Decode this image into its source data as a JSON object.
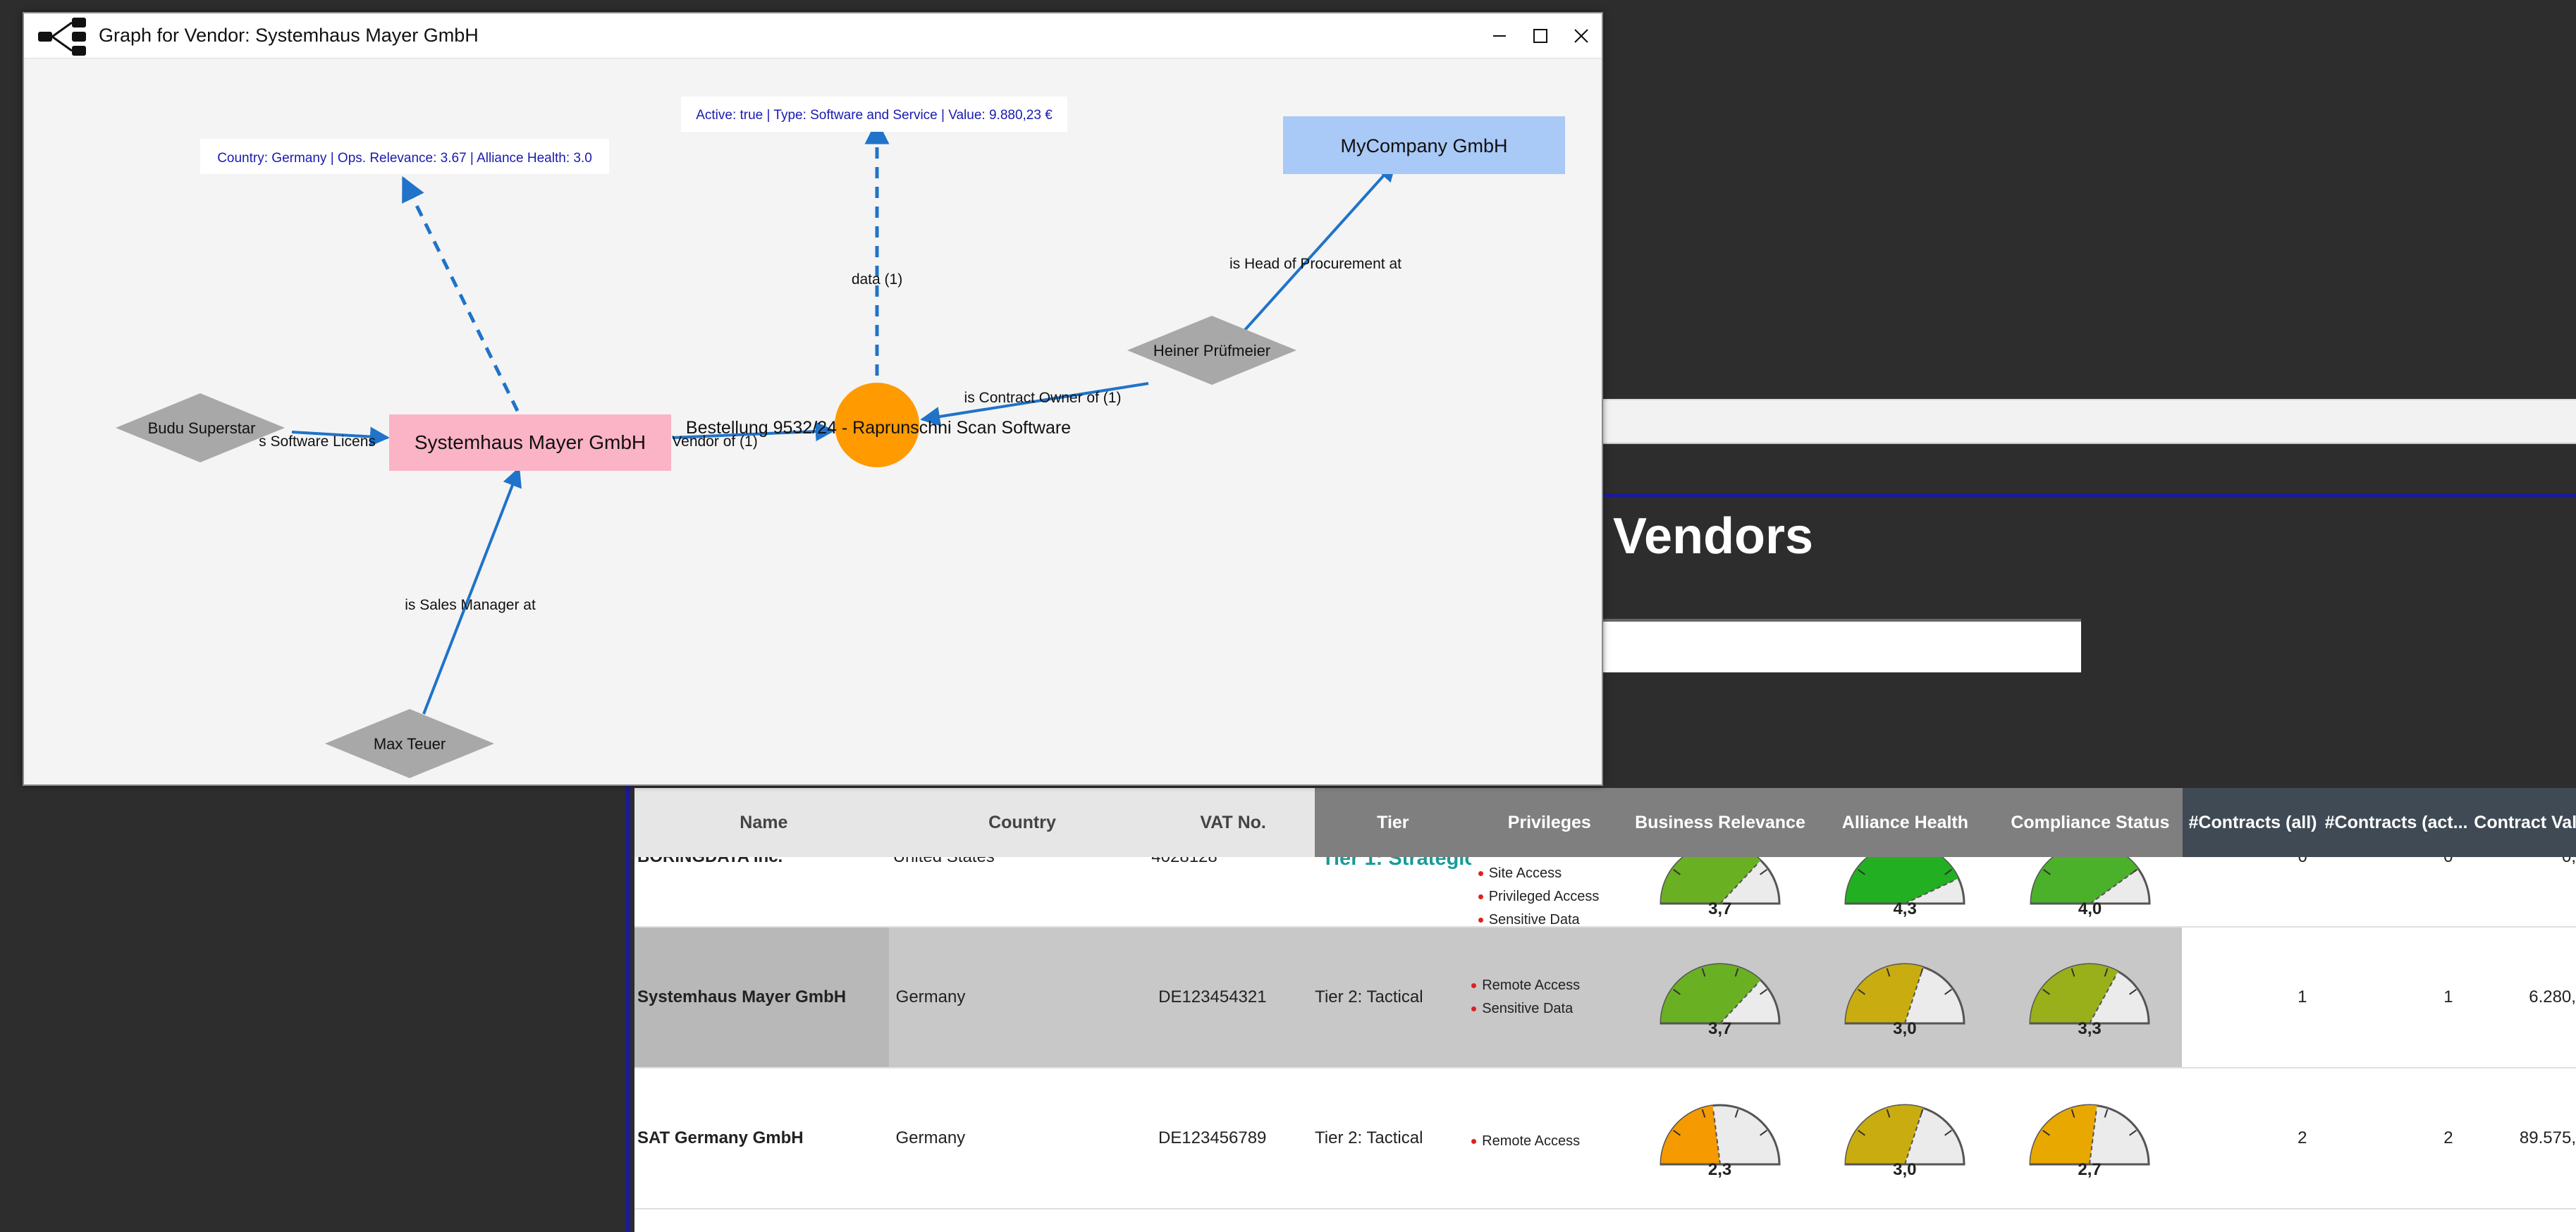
{
  "graph_window": {
    "title": "Graph for Vendor: Systemhaus Mayer GmbH",
    "controls": {
      "minimize": "—",
      "maximize": "☐",
      "close": "✕"
    },
    "nodes": {
      "vendor": "Systemhaus Mayer GmbH",
      "order": "Bestellung 9532/24 - Raprunschni Scan Software",
      "company": "MyCompany GmbH",
      "budu": "Budu Superstar",
      "heiner": "Heiner Prüfmeier",
      "max": "Max Teuer"
    },
    "info_boxes": {
      "vendor_info": "Country: Germany | Ops. Relevance: 3.67 | Alliance Health: 3.0",
      "order_info": "Active: true | Type: Software and Service | Value: 9.880,23 €"
    },
    "edges": {
      "data": "data (1)",
      "head_procurement": "is Head of Procurement at",
      "contract_owner": "is Contract Owner of (1)",
      "software_license": "s Software Licens",
      "vendor_of": "Vendor of (1)",
      "sales_manager": "is Sales Manager at"
    },
    "colors": {
      "vendor_fill": "#fbb3c6",
      "order_fill": "#ff9a00",
      "company_fill": "#a9c9f7",
      "person_fill": "#a8a8a8",
      "edge_color": "#1f73c9",
      "info_text": "#1a1ab0"
    }
  },
  "background": {
    "page_title": "Vendors"
  },
  "table": {
    "headers": [
      "Name",
      "Country",
      "VAT No.",
      "Tier",
      "Privileges",
      "Business Relevance",
      "Alliance Health",
      "Compliance Status",
      "#Contracts (all)",
      "#Contracts (act...",
      "Contract Valu"
    ],
    "rows": [
      {
        "name": "BORINGDATA Inc.",
        "country": "United States",
        "vat": "4028128",
        "tier": "Tier 1: Strategic",
        "privileges": [
          "Site Access",
          "Privileged Access",
          "Sensitive Data"
        ],
        "business_relevance": "3,7",
        "alliance_health": "4,3",
        "compliance_status": "4,0",
        "contracts_all": "0",
        "contracts_active": "0",
        "contract_value": "0,"
      },
      {
        "name": "Systemhaus Mayer GmbH",
        "country": "Germany",
        "vat": "DE123454321",
        "tier": "Tier 2: Tactical",
        "privileges": [
          "Remote Access",
          "Sensitive Data"
        ],
        "business_relevance": "3,7",
        "alliance_health": "3,0",
        "compliance_status": "3,3",
        "contracts_all": "1",
        "contracts_active": "1",
        "contract_value": "6.280,"
      },
      {
        "name": "SAT Germany GmbH",
        "country": "Germany",
        "vat": "DE123456789",
        "tier": "Tier 2: Tactical",
        "privileges": [
          "Remote Access"
        ],
        "business_relevance": "2,3",
        "alliance_health": "3,0",
        "compliance_status": "2,7",
        "contracts_all": "2",
        "contracts_active": "2",
        "contract_value": "89.575,"
      }
    ],
    "gauge_scale_max": 5
  }
}
